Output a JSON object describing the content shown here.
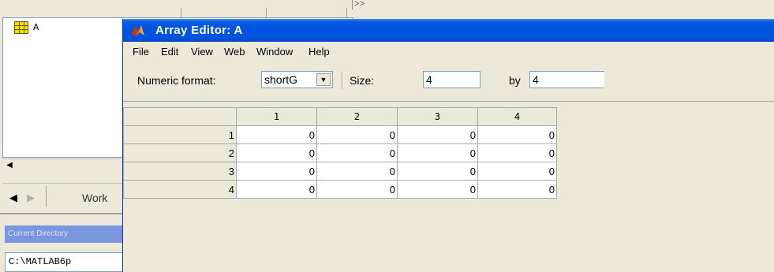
{
  "background": {
    "workspace_variable": "A",
    "tab_label": "Work",
    "current_directory_title": "Current Directory",
    "current_directory_path": "C:\\MATLAB6p",
    "command_prompt": ">>"
  },
  "editor": {
    "title": "Array Editor: A",
    "menu": [
      "File",
      "Edit",
      "View",
      "Web",
      "Window",
      "Help"
    ],
    "toolbar": {
      "numeric_format_label": "Numeric format:",
      "numeric_format_value": "shortG",
      "size_label": "Size:",
      "rows": "4",
      "by_label": "by",
      "cols": "4"
    },
    "grid": {
      "column_headers": [
        "1",
        "2",
        "3",
        "4"
      ],
      "row_headers": [
        "1",
        "2",
        "3",
        "4"
      ],
      "cells": [
        [
          "0",
          "0",
          "0",
          "0"
        ],
        [
          "0",
          "0",
          "0",
          "0"
        ],
        [
          "0",
          "0",
          "0",
          "0"
        ],
        [
          "0",
          "0",
          "0",
          "0"
        ]
      ]
    }
  },
  "colors": {
    "titlebar": "#0053e1",
    "window_bg": "#ece9d8",
    "curdir_title_bg": "#7a96df"
  }
}
